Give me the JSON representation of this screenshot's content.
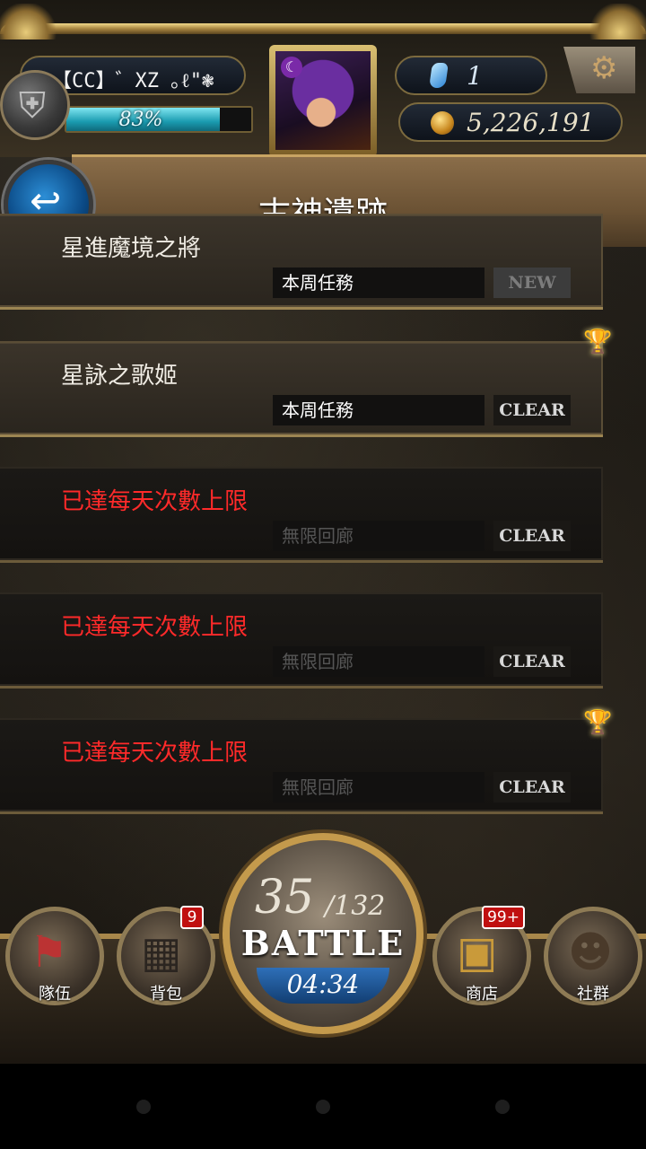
{
  "header": {
    "player_name": "【CC】゛XZ ｡ℓ\"❃",
    "exp_percent_label": "83%",
    "exp_fraction": 0.83,
    "gem_count": "1",
    "coin_count": "5,226,191",
    "guild_icon": "shield-icon",
    "settings_icon": "gear-icon"
  },
  "page": {
    "title": "古神遺跡",
    "back_icon": "back-arrow-icon"
  },
  "quests": [
    {
      "title": "星進魔境之將",
      "type": "本周任務",
      "status": "NEW"
    },
    {
      "title": "星詠之歌姬",
      "type": "本周任務",
      "status": "CLEAR"
    },
    {
      "title": "已達每天次數上限",
      "type": "無限回廊",
      "status": "CLEAR"
    },
    {
      "title": "已達每天次數上限",
      "type": "無限回廊",
      "status": "CLEAR"
    },
    {
      "title": "已達每天次數上限",
      "type": "無限回廊",
      "status": "CLEAR"
    }
  ],
  "nav": {
    "team_label": "隊伍",
    "bag_label": "背包",
    "bag_badge": "9",
    "shop_label": "商店",
    "shop_badge": "99+",
    "social_label": "社群"
  },
  "battle": {
    "stamina_current": "35",
    "stamina_max": "/132",
    "label": "BATTLE",
    "timer": "04:34"
  },
  "colors": {
    "gold": "#c49a4c",
    "limit_red": "#ff2a2a",
    "exp_cyan": "#1a9bb0",
    "back_blue": "#0b4a86"
  }
}
